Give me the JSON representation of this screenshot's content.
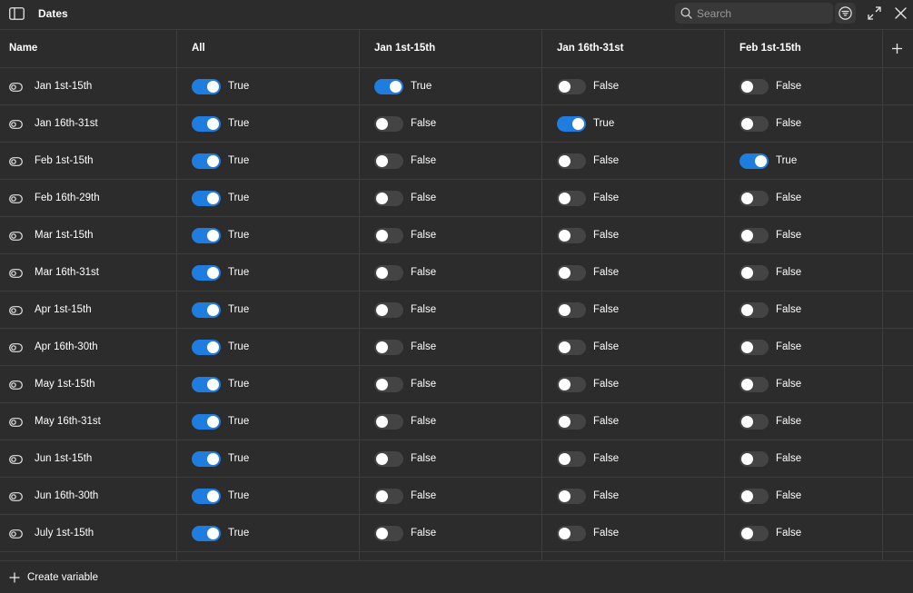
{
  "window": {
    "title": "Dates"
  },
  "search": {
    "placeholder": "Search",
    "value": ""
  },
  "icons": {
    "sidebar_toggle": "sidebar-icon",
    "search": "search-icon",
    "filter": "filter-icon",
    "expand": "expand-icon",
    "close": "close-icon",
    "add_column": "plus-icon",
    "variable": "toggle-variable-icon",
    "create": "plus-icon"
  },
  "colors": {
    "background": "#2c2c2c",
    "divider": "#3d3d3d",
    "toggle_on": "#1f7de0",
    "toggle_off": "#444444",
    "text": "#ffffff"
  },
  "columns": [
    {
      "id": "name",
      "label": "Name"
    },
    {
      "id": "all",
      "label": "All"
    },
    {
      "id": "jan1",
      "label": "Jan 1st-15th"
    },
    {
      "id": "jan16",
      "label": "Jan 16th-31st"
    },
    {
      "id": "feb1",
      "label": "Feb 1st-15th"
    }
  ],
  "rows": [
    {
      "name": "Jan 1st-15th",
      "values": [
        true,
        true,
        false,
        false
      ]
    },
    {
      "name": "Jan 16th-31st",
      "values": [
        true,
        false,
        true,
        false
      ]
    },
    {
      "name": "Feb 1st-15th",
      "values": [
        true,
        false,
        false,
        true
      ]
    },
    {
      "name": "Feb 16th-29th",
      "values": [
        true,
        false,
        false,
        false
      ]
    },
    {
      "name": "Mar 1st-15th",
      "values": [
        true,
        false,
        false,
        false
      ]
    },
    {
      "name": "Mar 16th-31st",
      "values": [
        true,
        false,
        false,
        false
      ]
    },
    {
      "name": "Apr 1st-15th",
      "values": [
        true,
        false,
        false,
        false
      ]
    },
    {
      "name": "Apr 16th-30th",
      "values": [
        true,
        false,
        false,
        false
      ]
    },
    {
      "name": "May 1st-15th",
      "values": [
        true,
        false,
        false,
        false
      ]
    },
    {
      "name": "May 16th-31st",
      "values": [
        true,
        false,
        false,
        false
      ]
    },
    {
      "name": "Jun 1st-15th",
      "values": [
        true,
        false,
        false,
        false
      ]
    },
    {
      "name": "Jun 16th-30th",
      "values": [
        true,
        false,
        false,
        false
      ]
    },
    {
      "name": "July 1st-15th",
      "values": [
        true,
        false,
        false,
        false
      ]
    }
  ],
  "value_labels": {
    "true": "True",
    "false": "False"
  },
  "footer": {
    "create_label": "Create variable"
  }
}
